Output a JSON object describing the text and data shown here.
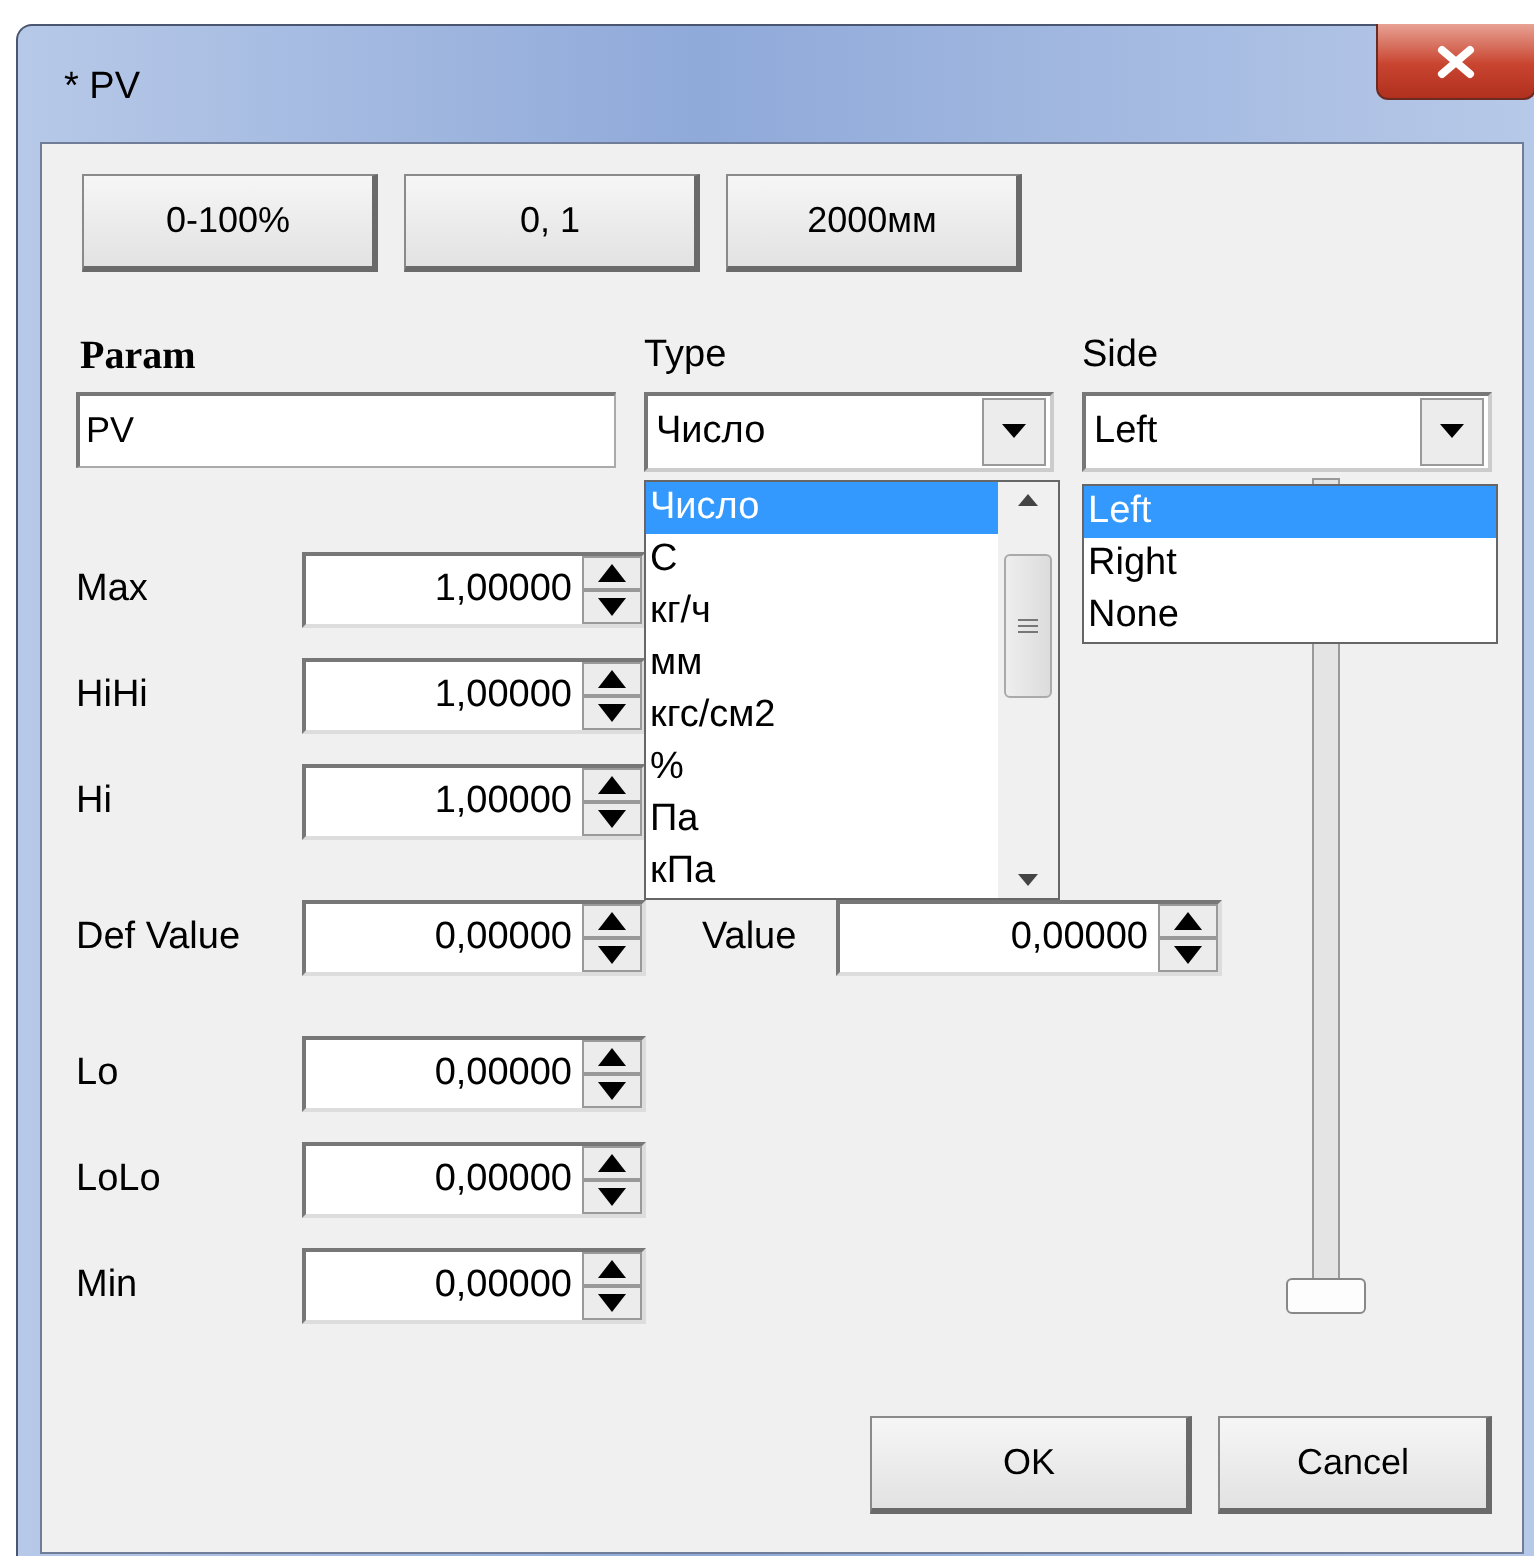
{
  "window": {
    "title": "* PV"
  },
  "preset_buttons": [
    "0-100%",
    "0, 1",
    "2000мм"
  ],
  "param": {
    "label": "Param",
    "value": "PV"
  },
  "type": {
    "label": "Type",
    "value": "Число",
    "expanded": true,
    "options": [
      {
        "label": "Число",
        "selected": true
      },
      {
        "label": "C",
        "selected": false
      },
      {
        "label": "кг/ч",
        "selected": false
      },
      {
        "label": "мм",
        "selected": false
      },
      {
        "label": "кгс/см2",
        "selected": false
      },
      {
        "label": "%",
        "selected": false
      },
      {
        "label": "Па",
        "selected": false
      },
      {
        "label": "кПа",
        "selected": false
      }
    ]
  },
  "side": {
    "label": "Side",
    "value": "Left",
    "expanded": true,
    "options": [
      {
        "label": "Left",
        "selected": true
      },
      {
        "label": "Right",
        "selected": false
      },
      {
        "label": "None",
        "selected": false
      }
    ]
  },
  "limits": [
    {
      "label": "Max",
      "value": "1,00000"
    },
    {
      "label": "HiHi",
      "value": "1,00000"
    },
    {
      "label": "Hi",
      "value": "1,00000"
    },
    {
      "label": "Def Value",
      "value": "0,00000",
      "companion": {
        "label": "Value",
        "value": "0,00000"
      }
    },
    {
      "label": "Lo",
      "value": "0,00000"
    },
    {
      "label": "LoLo",
      "value": "0,00000"
    },
    {
      "label": "Min",
      "value": "0,00000"
    }
  ],
  "slider": {
    "level": 0
  },
  "buttons": [
    "OK",
    "Cancel"
  ]
}
